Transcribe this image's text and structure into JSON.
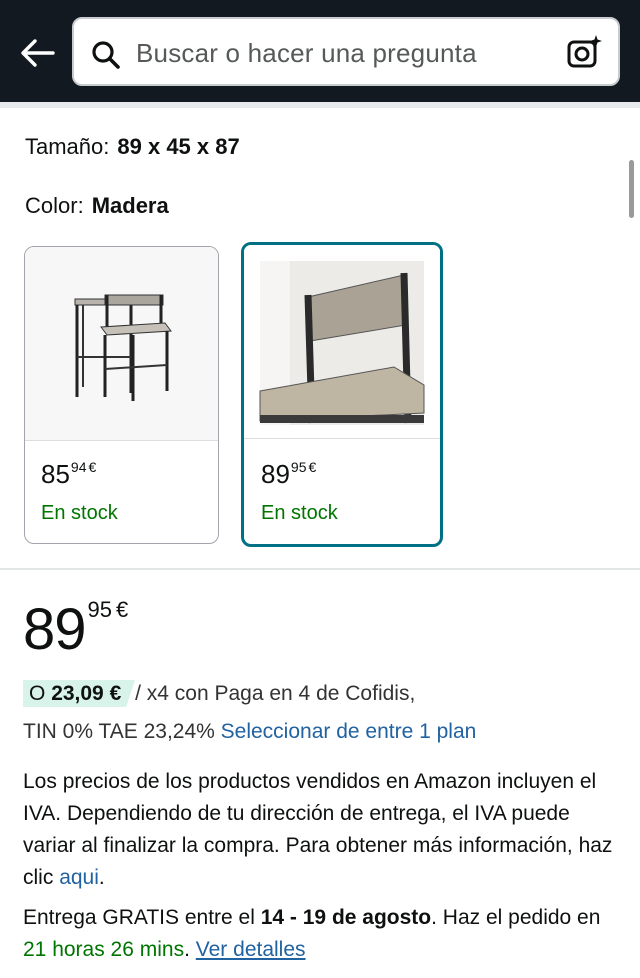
{
  "search": {
    "placeholder": "Buscar o hacer una pregunta"
  },
  "variations": {
    "size_label": "Tamaño:",
    "size_value": "89 x 45 x 87",
    "color_label": "Color:",
    "color_value": "Madera"
  },
  "options": [
    {
      "price_whole": "85",
      "price_fraction": "94",
      "currency": "€",
      "stock": "En stock",
      "selected": false
    },
    {
      "price_whole": "89",
      "price_fraction": "95",
      "currency": "€",
      "stock": "En stock",
      "selected": true
    }
  ],
  "price": {
    "whole": "89",
    "fraction": "95",
    "currency": "€"
  },
  "installments": {
    "prefix": "O",
    "amount": "23,09 €",
    "rest": "/ x4 con Paga en 4 de Cofidis,",
    "rates": "TIN 0% TAE 23,24%",
    "plan_link": "Seleccionar de entre 1 plan"
  },
  "tax": {
    "text": "Los precios de los productos vendidos en Amazon incluyen el IVA. Dependiendo de tu dirección de entrega, el IVA puede variar al finalizar la compra. Para obtener más información, haz clic",
    "link": "aqui",
    "end": "."
  },
  "delivery": {
    "prefix": "Entrega GRATIS entre el",
    "dates": "14 - 19 de agosto",
    "middle": ". Haz el pedido en",
    "countdown": "21 horas 26 mins",
    "sep": ".",
    "details_link": "Ver detalles"
  },
  "colors": {
    "header_bg": "#131921",
    "selected_border": "#007185",
    "in_stock": "#007600",
    "link": "#2162a1",
    "badge_bg": "#d8f3e9"
  },
  "icons": [
    "back-arrow-icon",
    "search-icon",
    "camera-search-icon"
  ]
}
